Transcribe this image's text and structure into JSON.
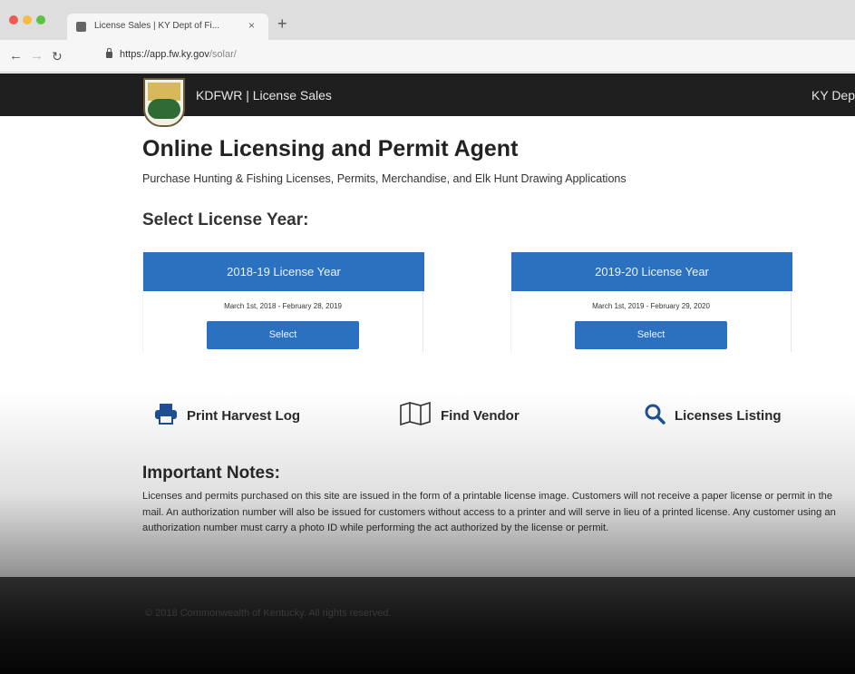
{
  "browser": {
    "tab_title": "License Sales | KY Dept of Fi...",
    "tab_close": "×",
    "new_tab": "+",
    "url_host": "https://app.fw.ky.gov",
    "url_path": "/solar/"
  },
  "header": {
    "brand": "KDFWR | License Sales",
    "right_text": "KY Dep"
  },
  "main": {
    "title": "Online Licensing and Permit Agent",
    "subtitle": "Purchase Hunting & Fishing Licenses, Permits, Merchandise, and Elk Hunt Drawing Applications",
    "select_heading": "Select License Year:",
    "license_years": [
      {
        "label": "2018-19 License Year",
        "range": "March 1st, 2018 - February 28, 2019",
        "button": "Select"
      },
      {
        "label": "2019-20 License Year",
        "range": "March 1st, 2019 - February 29, 2020",
        "button": "Select"
      }
    ],
    "quick_links": [
      {
        "label": "Print Harvest Log",
        "icon": "printer-icon"
      },
      {
        "label": "Find Vendor",
        "icon": "map-icon"
      },
      {
        "label": "Licenses Listing",
        "icon": "search-icon"
      }
    ]
  },
  "notes": {
    "heading": "Important Notes:",
    "body": "Licenses and permits purchased on this site are issued in the form of a printable license image. Customers will not receive a paper license or permit in the mail. An authorization number will also be issued for customers without access to a printer and will serve in lieu of a printed license. Any customer using an authorization number must carry a photo ID while performing the act authorized by the license or permit."
  },
  "footer": {
    "text": "© 2018 Commonwealth of Kentucky. All rights reserved."
  },
  "colors": {
    "primary": "#2b71c0",
    "header_bg": "#1f1f1f"
  }
}
